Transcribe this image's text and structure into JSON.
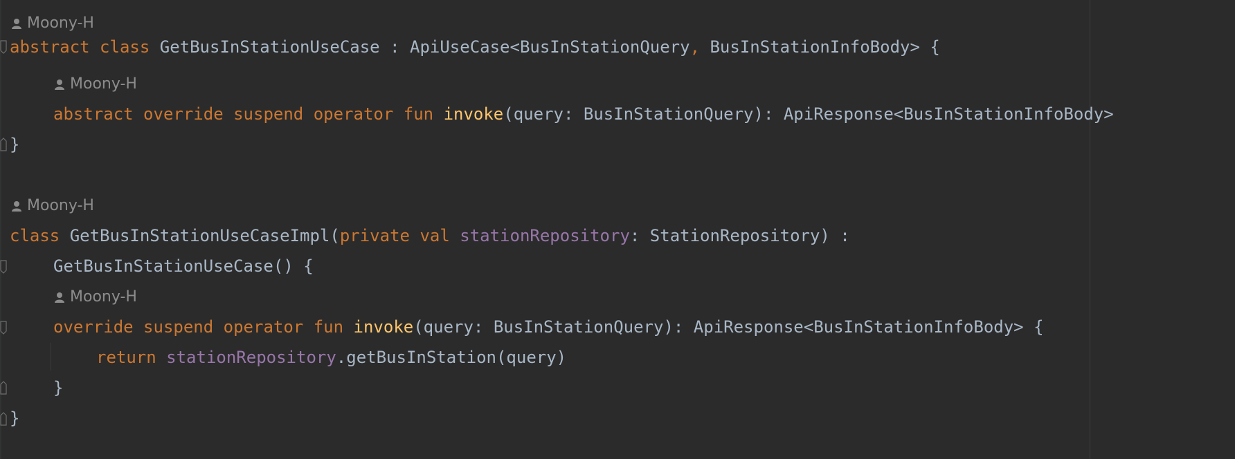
{
  "author_hints": [
    {
      "name": "Moony-H"
    },
    {
      "name": "Moony-H"
    },
    {
      "name": "Moony-H"
    },
    {
      "name": "Moony-H"
    }
  ],
  "code": {
    "l1": {
      "kw1": "abstract",
      "kw2": "class",
      "name": "GetBusInStationUseCase",
      "colon": " : ",
      "base": "ApiUseCase<BusInStationQuery",
      "comma": ",",
      "base2": " BusInStationInfoBody> {"
    },
    "l2": {
      "kw1": "abstract",
      "kw2": "override",
      "kw3": "suspend",
      "kw4": "operator",
      "kw5": "fun",
      "fn": "invoke",
      "rest": "(query: BusInStationQuery): ApiResponse<BusInStationInfoBody>"
    },
    "l3": {
      "text": "}"
    },
    "l4": {
      "kw1": "class",
      "name": " GetBusInStationUseCaseImpl(",
      "kw2": "private",
      "kw3": "val",
      "prop": "stationRepository",
      "rest": ": StationRepository) :"
    },
    "l5": {
      "text": "GetBusInStationUseCase() {"
    },
    "l6": {
      "kw1": "override",
      "kw2": "suspend",
      "kw3": "operator",
      "kw4": "fun",
      "fn": "invoke",
      "rest": "(query: BusInStationQuery): ApiResponse<BusInStationInfoBody> {"
    },
    "l7": {
      "kw": "return",
      "prop": "stationRepository",
      "rest": ".getBusInStation(query)"
    },
    "l8": {
      "text": "}"
    },
    "l9": {
      "text": "}"
    }
  },
  "colors": {
    "background": "#2b2b2b",
    "keyword": "#cc7832",
    "function": "#ffc66d",
    "property": "#9876aa",
    "default_text": "#a9b7c6",
    "hint": "#8c8c8c"
  },
  "icons": {
    "author": "user-icon",
    "fold": "fold-marker-icon"
  }
}
